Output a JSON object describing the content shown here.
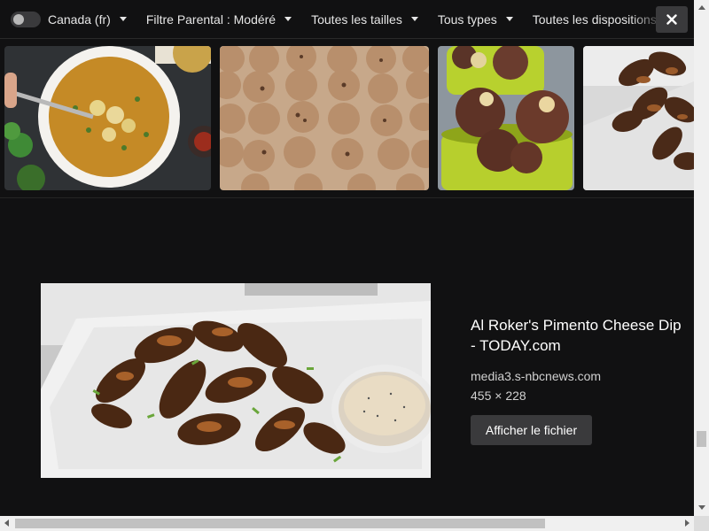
{
  "filters": {
    "region": "Canada (fr)",
    "safe_search": "Filtre Parental : Modéré",
    "size": "Toutes les tailles",
    "type": "Tous types",
    "layout": "Toutes les dispositions"
  },
  "close_icon_glyph": "✕",
  "detail": {
    "title": "Al Roker's Pimento Cheese Dip - TODAY.com",
    "domain": "media3.s-nbcnews.com",
    "dimensions": "455 × 228",
    "view_button_label": "Afficher le fichier"
  },
  "thumbnails": [
    {
      "subject": "soup-bowl"
    },
    {
      "subject": "muffins-on-rack"
    },
    {
      "subject": "meatballs-in-green-cup"
    },
    {
      "subject": "grilled-wings"
    }
  ],
  "icons": {
    "toggle": "toggle-switch-icon",
    "caret": "chevron-down-icon",
    "close": "close-icon"
  },
  "colors": {
    "background": "#111112",
    "button": "#3a3a3c",
    "text": "#ffffff"
  }
}
